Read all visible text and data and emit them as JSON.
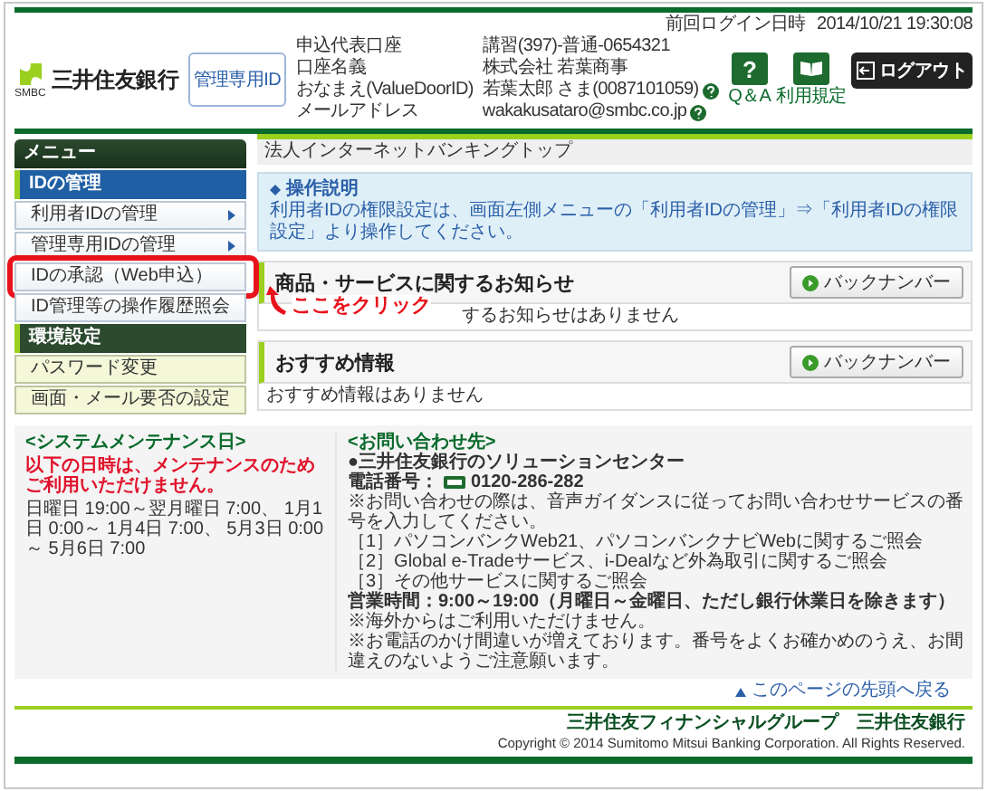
{
  "header": {
    "logo_caption": "SMBC",
    "bank_name": "三井住友銀行",
    "id_badge": "管理専用ID",
    "last_login": {
      "label": "前回ログイン日時",
      "value": "2014/10/21 19:30:08"
    },
    "account_info": [
      {
        "label": "申込代表口座",
        "value": "講習(397)-普通-0654321",
        "help": false
      },
      {
        "label": "口座名義",
        "value": "株式会社 若葉商事",
        "help": false
      },
      {
        "label": "おなまえ(ValueDoorID)",
        "value": "若葉太郎 さま(0087101059)",
        "help": true
      },
      {
        "label": "メールアドレス",
        "value": "wakakusataro@smbc.co.jp",
        "help": true
      }
    ],
    "buttons": [
      {
        "kind": "help",
        "symbol": "?",
        "label": "Q＆A"
      },
      {
        "kind": "terms",
        "label": "利用規定"
      },
      {
        "kind": "logout",
        "label": "ログアウト"
      }
    ]
  },
  "sidebar": {
    "title": "メニュー",
    "groups": [
      {
        "title": "IDの管理",
        "items": [
          {
            "label": "利用者IDの管理",
            "submenu": true,
            "highlighted": false
          },
          {
            "label": "管理専用IDの管理",
            "submenu": true,
            "highlighted": false
          },
          {
            "label": "IDの承認（Web申込）",
            "submenu": false,
            "highlighted": true
          },
          {
            "label": "ID管理等の操作履歴照会",
            "submenu": false,
            "highlighted": false
          }
        ]
      },
      {
        "title": "環境設定",
        "items": [
          {
            "label": "パスワード変更",
            "submenu": false,
            "highlighted": false
          },
          {
            "label": "画面・メール要否の設定",
            "submenu": false,
            "highlighted": false
          }
        ]
      }
    ]
  },
  "callout": {
    "text": "ここをクリック"
  },
  "breadcrumb": "法人インターネットバンキングトップ",
  "instructions": {
    "title": "操作説明",
    "text": "利用者IDの権限設定は、画面左側メニューの「利用者IDの管理」⇒「利用者IDの権限設定」より操作してください。"
  },
  "notices": [
    {
      "title": "商品・サービスに関するお知らせ",
      "button": "バックナンバー",
      "body": "するお知らせはありません"
    },
    {
      "title": "おすすめ情報",
      "button": "バックナンバー",
      "body": "おすすめ情報はありません"
    }
  ],
  "maintenance": {
    "title": "<システムメンテナンス日>",
    "notice": "以下の日時は、メンテナンスのためご利用いただけません。",
    "schedule": "日曜日 19:00～翌月曜日 7:00、 1月1日 0:00～ 1月4日 7:00、 5月3日 0:00～ 5月6日 7:00"
  },
  "contact": {
    "lines": [
      {
        "kind": "title",
        "text": "<お問い合わせ先>"
      },
      {
        "kind": "heading",
        "text": "●三井住友銀行のソリューションセンター"
      },
      {
        "kind": "phone",
        "label": "電話番号：",
        "text": "0120-286-282"
      },
      {
        "kind": "text",
        "text": "※お問い合わせの際は、音声ガイダンスに従ってお問い合わせサービスの番号を入力してください。"
      },
      {
        "kind": "text",
        "text": "［1］パソコンバンクWeb21、パソコンバンクナビWebに関するご照会"
      },
      {
        "kind": "text",
        "text": "［2］Global e-Tradeサービス、i-Dealなど外為取引に関するご照会"
      },
      {
        "kind": "text",
        "text": "［3］その他サービスに関するご照会"
      },
      {
        "kind": "hours",
        "text": "営業時間：9:00～19:00（月曜日～金曜日、ただし銀行休業日を除きます）"
      },
      {
        "kind": "text",
        "text": "※海外からはご利用いただけません。"
      },
      {
        "kind": "text",
        "text": "※お電話のかけ間違いが増えております。番号をよくお確かめのうえ、お間違えのないようご注意願います。"
      }
    ]
  },
  "back_to_top": "このページの先頭へ戻る",
  "footer": {
    "brands": [
      "三井住友フィナンシャルグループ",
      "三井住友銀行"
    ],
    "copyright": "Copyright © 2014 Sumitomo Mitsui Banking Corporation. All Rights Reserved."
  }
}
